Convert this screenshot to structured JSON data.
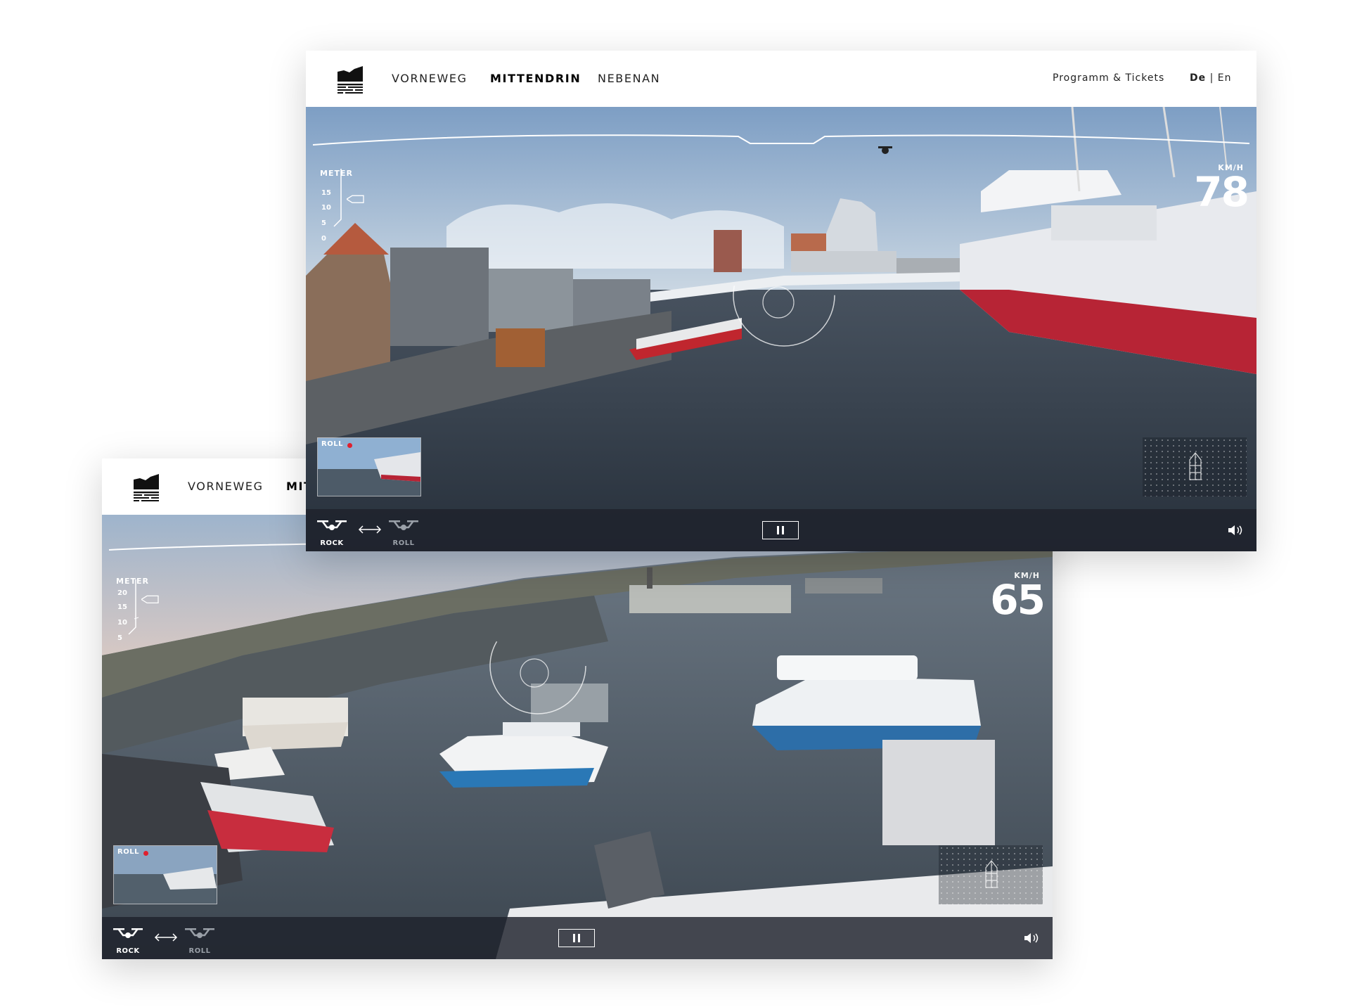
{
  "nav": {
    "items": [
      {
        "label": "VORNEWEG"
      },
      {
        "label": "MITTENDRIN"
      },
      {
        "label": "NEBENAN"
      }
    ],
    "program_link": "Programm & Tickets",
    "lang_de": "De",
    "lang_sep": " | ",
    "lang_en": "En"
  },
  "back_nav": {
    "vorneweg": "VORNEWEG",
    "mittendrin_partial": "MIT"
  },
  "front_video": {
    "speed_unit": "KM/H",
    "speed": "78",
    "meter_label": "METER",
    "meter_ticks": [
      "15",
      "10",
      "5",
      "0"
    ],
    "altitude_fraction": 0.6,
    "pip_label": "ROLL",
    "drone_a": "ROCK",
    "drone_b": "ROLL"
  },
  "back_video": {
    "speed_unit": "KM/H",
    "speed": "65",
    "meter_label": "METER",
    "meter_ticks": [
      "20",
      "15",
      "10",
      "5"
    ],
    "altitude_fraction": 0.6,
    "pip_label": "ROLL",
    "drone_a": "ROCK",
    "drone_b": "ROLL"
  },
  "icons": {
    "logo": "elbphilharmonie-logo-icon",
    "drone": "drone-icon",
    "swap": "swap-arrow-icon",
    "pause": "pause-icon",
    "volume": "volume-icon",
    "minimap": "building-outline-icon"
  },
  "colors": {
    "accent_red": "#e0202e",
    "control_bar": "#1e222c",
    "active_drone": "#ffffff",
    "inactive_drone": "#9aa0a8"
  }
}
